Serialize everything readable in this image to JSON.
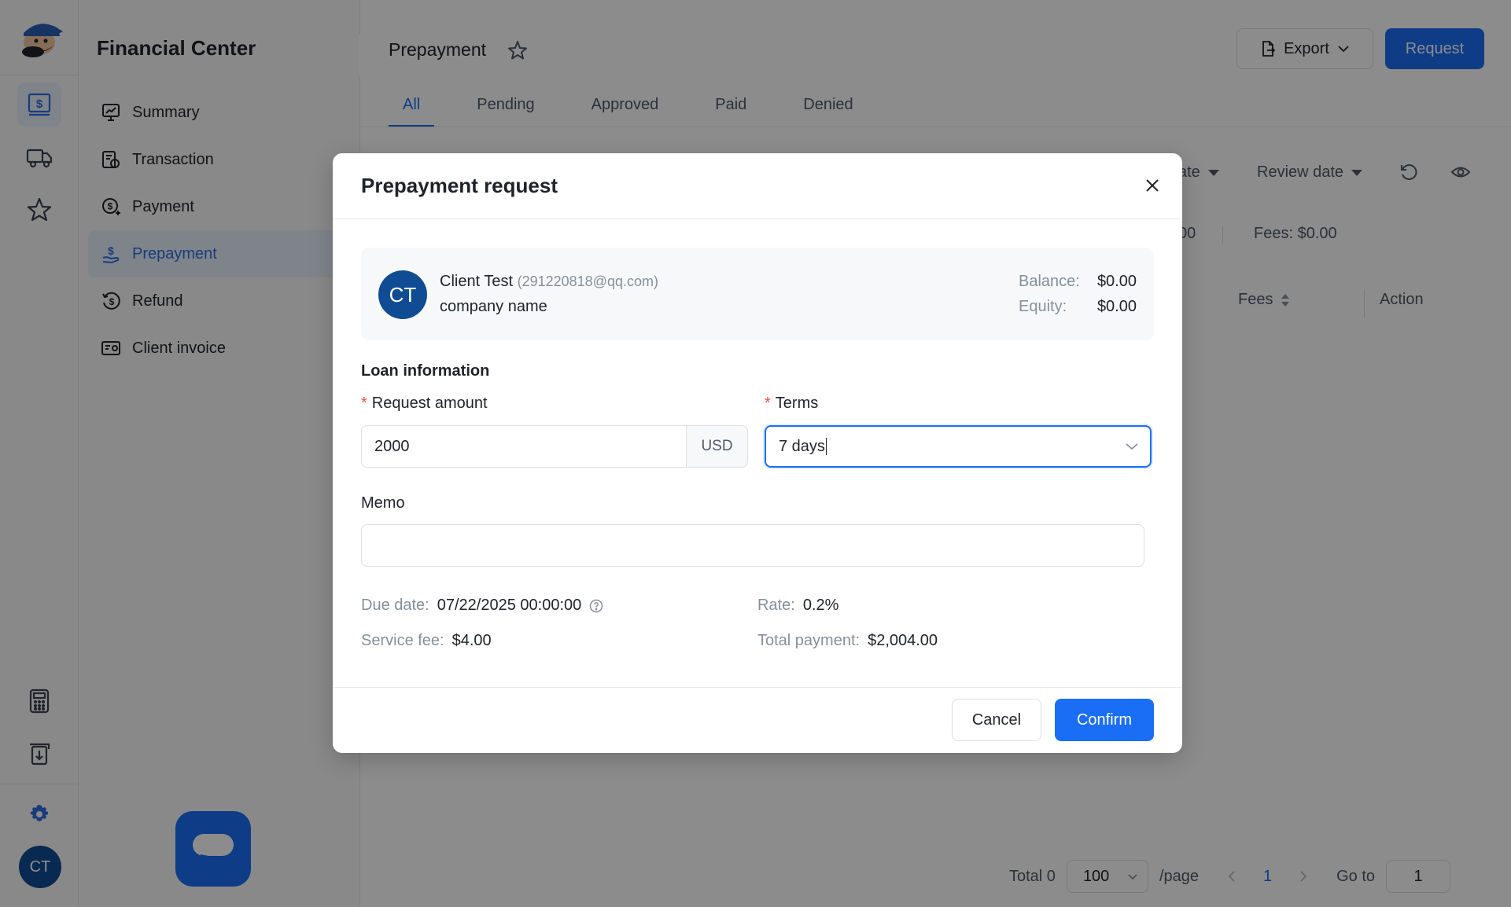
{
  "app": {
    "section_title": "Financial Center",
    "user_initials": "CT"
  },
  "rail": {
    "items": [
      {
        "icon": "finance-icon",
        "active": true
      },
      {
        "icon": "truck-icon",
        "active": false
      },
      {
        "icon": "star-icon",
        "active": false
      },
      {
        "icon": "calculator-icon",
        "active": false
      },
      {
        "icon": "download-doc-icon",
        "active": false
      },
      {
        "icon": "gear-icon",
        "active": false
      }
    ]
  },
  "sidebar": {
    "items": [
      {
        "label": "Summary",
        "icon": "chart-icon"
      },
      {
        "label": "Transaction",
        "icon": "transaction-icon"
      },
      {
        "label": "Payment",
        "icon": "payment-icon"
      },
      {
        "label": "Prepayment",
        "icon": "prepayment-icon",
        "active": true
      },
      {
        "label": "Refund",
        "icon": "refund-icon"
      },
      {
        "label": "Client invoice",
        "icon": "invoice-icon"
      }
    ]
  },
  "header": {
    "title": "Prepayment",
    "export_label": "Export",
    "request_label": "Request"
  },
  "tabs": [
    {
      "label": "All",
      "active": true
    },
    {
      "label": "Pending"
    },
    {
      "label": "Approved"
    },
    {
      "label": "Paid"
    },
    {
      "label": "Denied"
    }
  ],
  "filters": {
    "date_partial": "ate",
    "review_date": "Review date"
  },
  "summary": {
    "amount_partial": "00",
    "fees": "Fees: $0.00"
  },
  "table": {
    "columns": [
      "Fees",
      "Action"
    ]
  },
  "pagination": {
    "total": "Total 0",
    "page_size": "100",
    "per_page": "/page",
    "current_page": "1",
    "goto_label": "Go to",
    "goto_value": "1"
  },
  "modal": {
    "title": "Prepayment request",
    "client": {
      "initials": "CT",
      "name": "Client Test",
      "email": "(291220818@qq.com)",
      "company": "company name",
      "balance_label": "Balance:",
      "balance_value": "$0.00",
      "equity_label": "Equity:",
      "equity_value": "$0.00"
    },
    "section_title": "Loan information",
    "request_amount": {
      "label": "Request amount",
      "value": "2000",
      "currency": "USD"
    },
    "terms": {
      "label": "Terms",
      "value": "7 days"
    },
    "memo": {
      "label": "Memo",
      "value": ""
    },
    "details": {
      "due_date_label": "Due date:",
      "due_date_value": "07/22/2025 00:00:00",
      "rate_label": "Rate:",
      "rate_value": "0.2%",
      "service_fee_label": "Service fee:",
      "service_fee_value": "$4.00",
      "total_payment_label": "Total payment:",
      "total_payment_value": "$2,004.00"
    },
    "cancel_label": "Cancel",
    "confirm_label": "Confirm"
  },
  "colors": {
    "accent": "#1a6ef5",
    "avatar": "#0f4c94",
    "required": "#f54a45"
  }
}
